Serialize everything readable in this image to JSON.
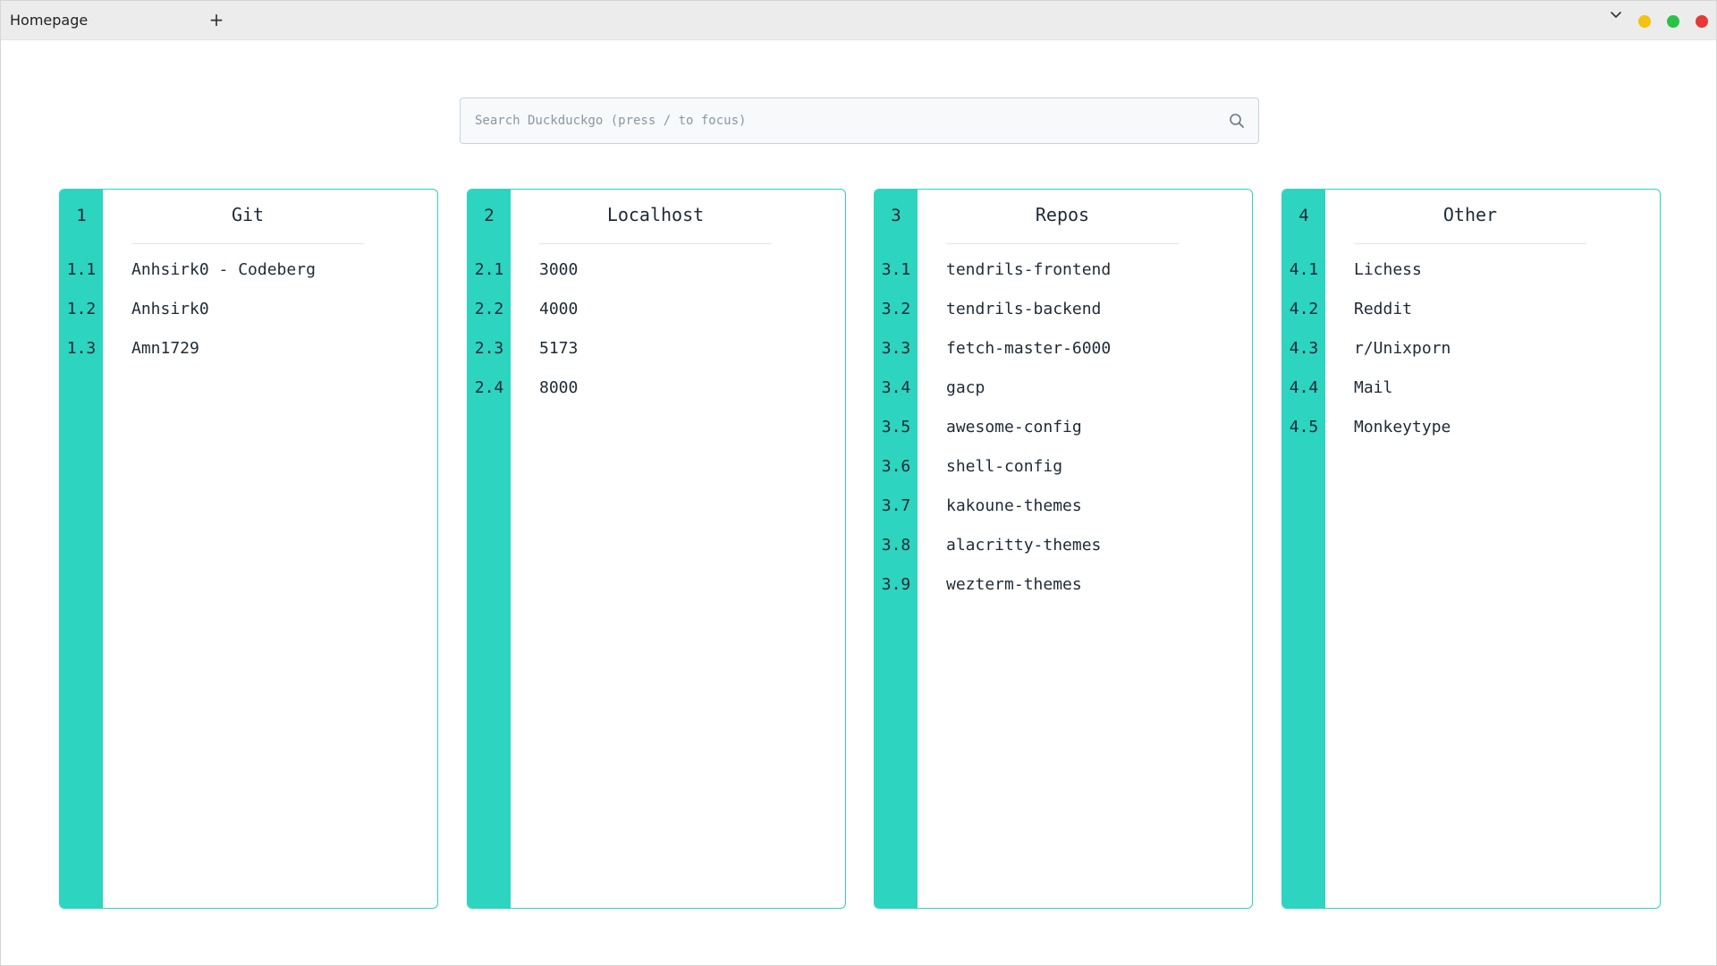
{
  "tab": {
    "title": "Homepage",
    "new_tab_label": "+"
  },
  "window_controls": [
    "chevron-down-icon",
    "minimize",
    "maximize",
    "close"
  ],
  "colors": {
    "accent": "#2dd4bf",
    "minimize": "#f5c211",
    "maximize": "#26c446",
    "close": "#e53935"
  },
  "search": {
    "placeholder": "Search Duckduckgo (press / to focus)",
    "value": "",
    "icon": "search-icon"
  },
  "cards": [
    {
      "number": "1",
      "title": "Git",
      "items": [
        {
          "index": "1.1",
          "label": "Anhsirk0 - Codeberg"
        },
        {
          "index": "1.2",
          "label": "Anhsirk0"
        },
        {
          "index": "1.3",
          "label": "Amn1729"
        }
      ]
    },
    {
      "number": "2",
      "title": "Localhost",
      "items": [
        {
          "index": "2.1",
          "label": "3000"
        },
        {
          "index": "2.2",
          "label": "4000"
        },
        {
          "index": "2.3",
          "label": "5173"
        },
        {
          "index": "2.4",
          "label": "8000"
        }
      ]
    },
    {
      "number": "3",
      "title": "Repos",
      "items": [
        {
          "index": "3.1",
          "label": "tendrils-frontend"
        },
        {
          "index": "3.2",
          "label": "tendrils-backend"
        },
        {
          "index": "3.3",
          "label": "fetch-master-6000"
        },
        {
          "index": "3.4",
          "label": "gacp"
        },
        {
          "index": "3.5",
          "label": "awesome-config"
        },
        {
          "index": "3.6",
          "label": "shell-config"
        },
        {
          "index": "3.7",
          "label": "kakoune-themes"
        },
        {
          "index": "3.8",
          "label": "alacritty-themes"
        },
        {
          "index": "3.9",
          "label": "wezterm-themes"
        }
      ]
    },
    {
      "number": "4",
      "title": "Other",
      "items": [
        {
          "index": "4.1",
          "label": "Lichess"
        },
        {
          "index": "4.2",
          "label": "Reddit"
        },
        {
          "index": "4.3",
          "label": "r/Unixporn"
        },
        {
          "index": "4.4",
          "label": "Mail"
        },
        {
          "index": "4.5",
          "label": "Monkeytype"
        }
      ]
    }
  ]
}
